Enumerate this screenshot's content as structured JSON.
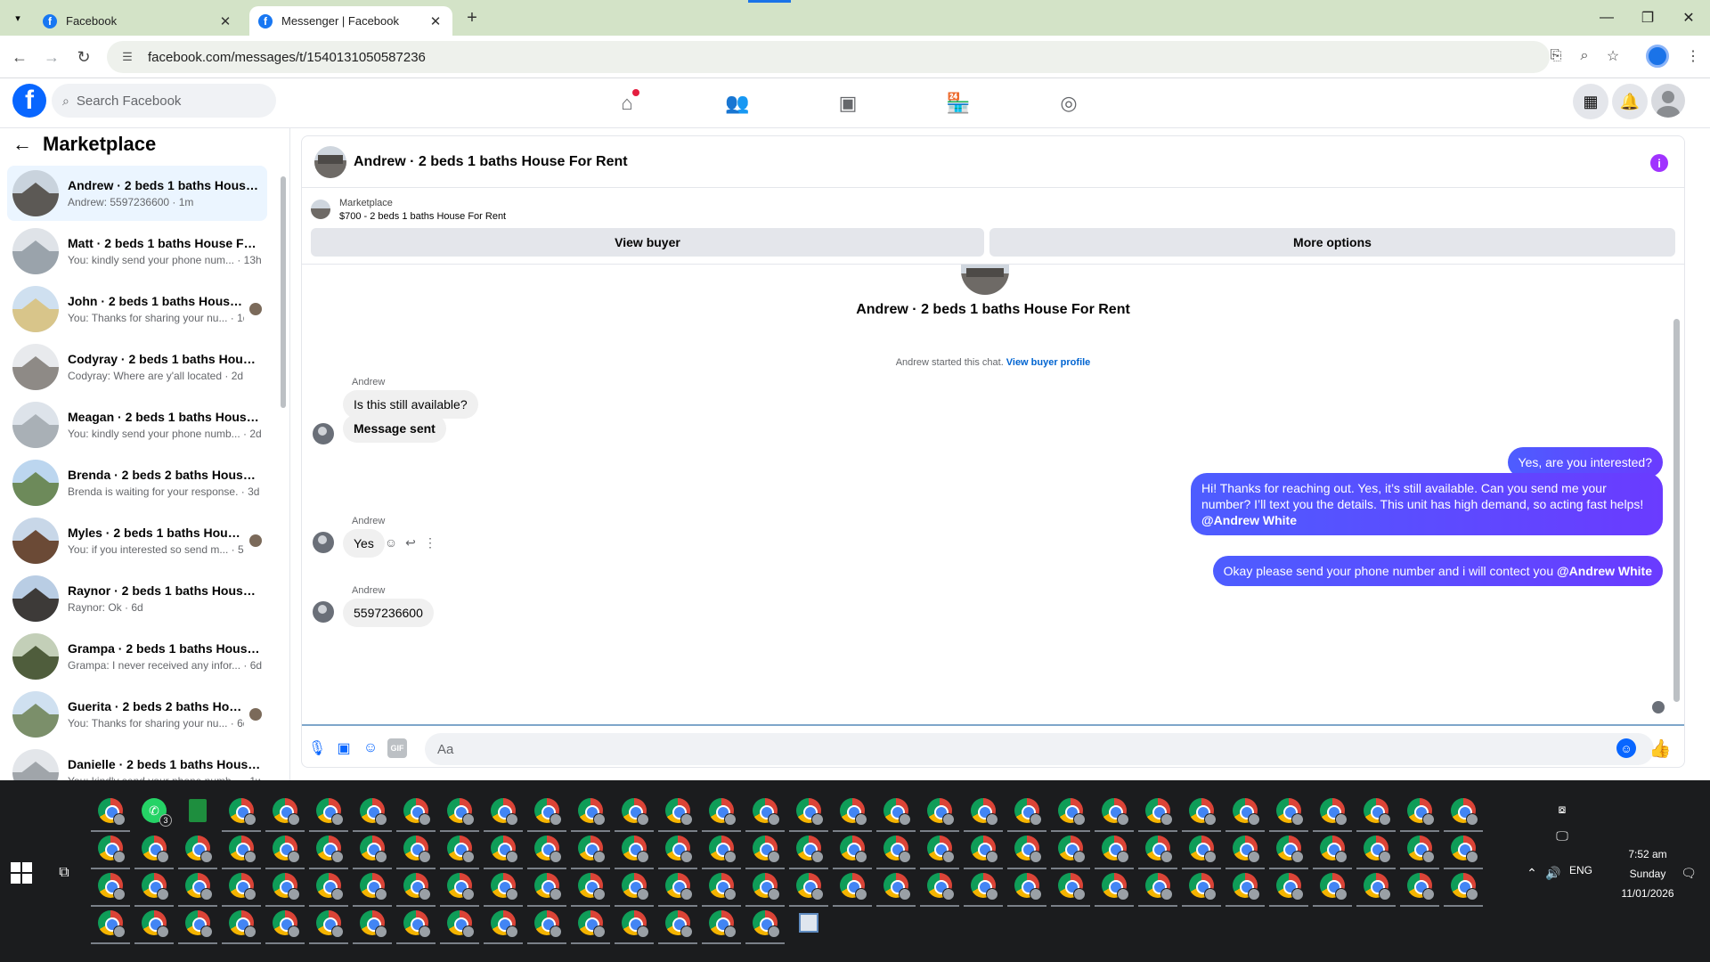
{
  "browser": {
    "tabs": [
      {
        "title": "Facebook",
        "active": false
      },
      {
        "title": "Messenger | Facebook",
        "active": true
      }
    ],
    "url": "facebook.com/messages/t/1540131050587236"
  },
  "facebook": {
    "search_placeholder": "Search Facebook",
    "logo_letter": "f"
  },
  "sidebar": {
    "title": "Marketplace",
    "conversations": [
      {
        "name": "Andrew · 2 beds 1 baths House ...",
        "preview": "Andrew: 5597236600 · 1m",
        "selected": true
      },
      {
        "name": "Matt · 2 beds 1 baths House For ...",
        "preview": "You: kindly send your phone num... · 13h"
      },
      {
        "name": "John · 2 beds 1 baths House F...",
        "preview": "You: Thanks for sharing your nu... · 1d"
      },
      {
        "name": "Codyray · 2 beds 1 baths House ...",
        "preview": "Codyray: Where are y'all located · 2d"
      },
      {
        "name": "Meagan · 2 beds 1 baths House ...",
        "preview": "You: kindly send your phone numb... · 2d"
      },
      {
        "name": "Brenda · 2 beds 2 baths House F...",
        "preview": "Brenda is waiting for your response. · 3d"
      },
      {
        "name": "Myles · 2 beds 1 baths House ...",
        "preview": "You: if you interested so send m... · 5d"
      },
      {
        "name": "Raynor · 2 beds 1 baths House F...",
        "preview": "Raynor: Ok · 6d"
      },
      {
        "name": "Grampa · 2 beds 1 baths House ...",
        "preview": "Grampa: I never received any infor... · 6d"
      },
      {
        "name": "Guerita · 2 beds 2 baths Hous...",
        "preview": "You: Thanks for sharing your nu... · 6d"
      },
      {
        "name": "Danielle · 2 beds 1 baths House ...",
        "preview": "You: kindly send your phone numb... · 1w"
      }
    ]
  },
  "chat": {
    "header_title": "Andrew · 2 beds 1 baths House For Rent",
    "listing_label": "Marketplace",
    "listing_price": "$700 - 2 beds 1 baths House For Rent",
    "view_buyer": "View buyer",
    "more_options": "More options",
    "conversation_title": "Andrew · 2 beds 1 baths House For Rent",
    "started_text": "Andrew started this chat.",
    "view_buyer_profile": "View buyer profile",
    "sender": "Andrew",
    "messages": {
      "m1": "Is this still available?",
      "m2": "Message sent",
      "o1": "Yes, are you interested?",
      "o2": "Hi! Thanks for reaching out. Yes, it’s still available. Can you send me your number? I’ll text you the details. This unit has high demand, so acting fast helps!",
      "o2_mention": "@Andrew White",
      "m3": "Yes",
      "o3": "Okay please send your phone number and i will contect you",
      "o3_mention": "@Andrew White",
      "m4": "5597236600"
    },
    "composer_placeholder": "Aa",
    "gif_label": "GIF"
  },
  "taskbar": {
    "whatsapp_badge": "3",
    "time": "7:52 am",
    "day": "Sunday",
    "date": "11/01/2026",
    "language": "ENG"
  },
  "colors": {
    "fb_blue": "#0866ff",
    "outgoing_bubble": "#5b3fff",
    "tab_strip": "#d3e3c7"
  }
}
